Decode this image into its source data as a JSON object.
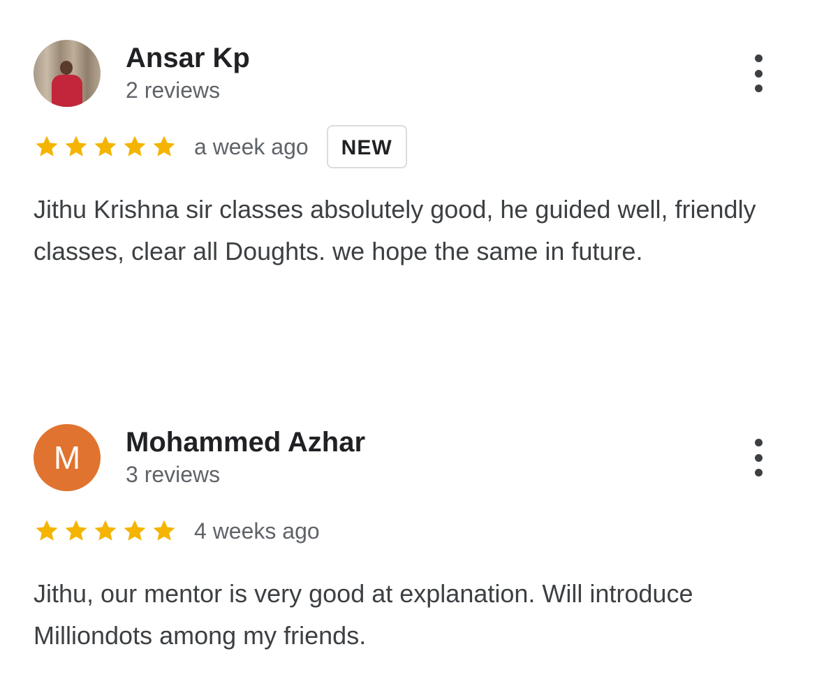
{
  "reviews": [
    {
      "name": "Ansar Kp",
      "count": "2 reviews",
      "avatar": {
        "type": "photo",
        "letter": ""
      },
      "rating": 5,
      "time": "a week ago",
      "badge": "NEW",
      "text": "Jithu Krishna sir classes absolutely good, he guided well, friendly classes, clear all Doughts. we hope the same in future."
    },
    {
      "name": "Mohammed Azhar",
      "count": "3 reviews",
      "avatar": {
        "type": "letter",
        "letter": "M",
        "color": "#e0732f"
      },
      "rating": 5,
      "time": "4 weeks ago",
      "badge": "",
      "text": "Jithu, our mentor is very good at explanation. Will introduce Milliondots among my friends."
    }
  ],
  "colors": {
    "star": "#f4b400",
    "name": "#202124",
    "secondary": "#5f6368",
    "body": "#3c4043"
  },
  "icons": {
    "star": "star-icon",
    "more": "more-vert-icon"
  }
}
